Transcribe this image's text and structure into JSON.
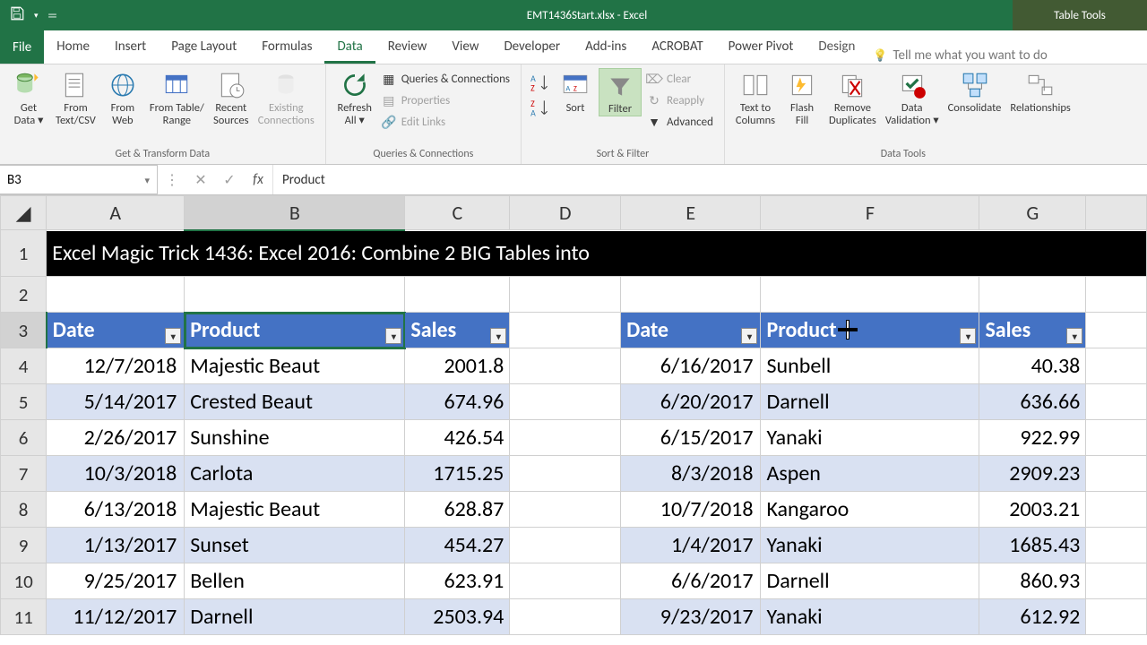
{
  "window": {
    "title": "EMT1436Start.xlsx - Excel",
    "context_tab_group": "Table Tools"
  },
  "tabs": {
    "file": "File",
    "items": [
      "Home",
      "Insert",
      "Page Layout",
      "Formulas",
      "Data",
      "Review",
      "View",
      "Developer",
      "Add-ins",
      "ACROBAT",
      "Power Pivot",
      "Design"
    ],
    "active": "Data",
    "tellme": "Tell me what you want to do"
  },
  "ribbon": {
    "groups": {
      "get_transform": {
        "caption": "Get & Transform Data",
        "get_data": "Get\nData ▾",
        "from_csv": "From\nText/CSV",
        "from_web": "From\nWeb",
        "from_table": "From Table/\nRange",
        "recent": "Recent\nSources",
        "existing": "Existing\nConnections"
      },
      "queries": {
        "caption": "Queries & Connections",
        "refresh": "Refresh\nAll ▾",
        "qc": "Queries & Connections",
        "props": "Properties",
        "edit_links": "Edit Links"
      },
      "sort_filter": {
        "caption": "Sort & Filter",
        "sort": "Sort",
        "filter": "Filter",
        "clear": "Clear",
        "reapply": "Reapply",
        "advanced": "Advanced"
      },
      "data_tools": {
        "caption": "Data Tools",
        "text_cols": "Text to\nColumns",
        "flash": "Flash\nFill",
        "dupes": "Remove\nDuplicates",
        "validation": "Data\nValidation ▾",
        "consolidate": "Consolidate",
        "relationships": "Relationships"
      }
    }
  },
  "formula_bar": {
    "name_box": "B3",
    "formula": "Product"
  },
  "sheet": {
    "columns": [
      "A",
      "B",
      "C",
      "D",
      "E",
      "F",
      "G"
    ],
    "row1_title": "Excel Magic Trick 1436: Excel 2016: Combine 2 BIG Tables into",
    "table1": {
      "headers": [
        "Date",
        "Product",
        "Sales"
      ],
      "rows": [
        [
          "12/7/2018",
          "Majestic Beaut",
          "2001.8"
        ],
        [
          "5/14/2017",
          "Crested Beaut",
          "674.96"
        ],
        [
          "2/26/2017",
          "Sunshine",
          "426.54"
        ],
        [
          "10/3/2018",
          "Carlota",
          "1715.25"
        ],
        [
          "6/13/2018",
          "Majestic Beaut",
          "628.87"
        ],
        [
          "1/13/2017",
          "Sunset",
          "454.27"
        ],
        [
          "9/25/2017",
          "Bellen",
          "623.91"
        ],
        [
          "11/12/2017",
          "Darnell",
          "2503.94"
        ]
      ]
    },
    "table2": {
      "headers": [
        "Date",
        "Product",
        "Sales"
      ],
      "rows": [
        [
          "6/16/2017",
          "Sunbell",
          "40.38"
        ],
        [
          "6/20/2017",
          "Darnell",
          "636.66"
        ],
        [
          "6/15/2017",
          "Yanaki",
          "922.99"
        ],
        [
          "8/3/2018",
          "Aspen",
          "2909.23"
        ],
        [
          "10/7/2018",
          "Kangaroo",
          "2003.21"
        ],
        [
          "1/4/2017",
          "Yanaki",
          "1685.43"
        ],
        [
          "6/6/2017",
          "Darnell",
          "860.93"
        ],
        [
          "9/23/2017",
          "Yanaki",
          "612.92"
        ]
      ]
    },
    "cursor_at": {
      "col": "F",
      "row": 3
    }
  }
}
